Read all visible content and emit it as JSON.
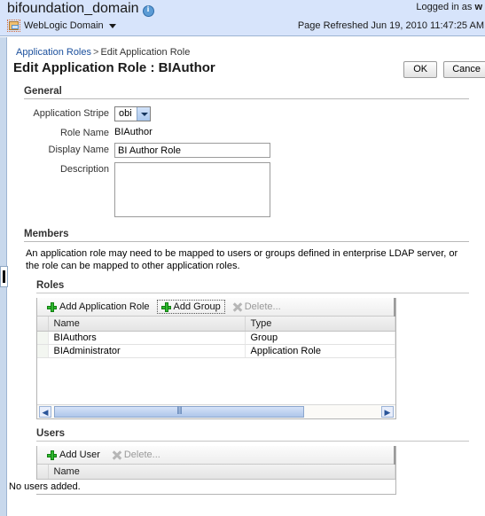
{
  "header": {
    "domain_title": "bifoundation_domain",
    "info_icon": "info-icon",
    "domain_menu_label": "WebLogic Domain",
    "domain_menu_icon": "weblogic-domain-icon",
    "caret_icon": "chevron-down-icon",
    "logged_in_prefix": "Logged in as",
    "logged_in_user": "w",
    "page_refreshed": "Page Refreshed Jun 19, 2010 11:47:25 AM",
    "background_color": "#d7e4fb"
  },
  "breadcrumb": {
    "parent": "Application Roles",
    "separator": ">",
    "current": "Edit Application Role"
  },
  "page": {
    "title": "Edit Application Role : BIAuthor"
  },
  "actions": {
    "ok_label": "OK",
    "cancel_label": "Cance"
  },
  "general": {
    "heading": "General",
    "fields": [
      {
        "label": "Application Stripe",
        "value": "obi",
        "type": "select"
      },
      {
        "label": "Role Name",
        "value": "BIAuthor",
        "type": "static"
      },
      {
        "label": "Display Name",
        "value": "BI Author Role",
        "type": "text"
      },
      {
        "label": "Description",
        "value": "",
        "type": "textarea"
      }
    ]
  },
  "members": {
    "heading": "Members",
    "description": "An application role may need to be mapped to users or groups defined in enterprise LDAP server, or the role can be mapped to other application roles.",
    "roles": {
      "heading": "Roles",
      "toolbar": {
        "add_application_role": "Add Application Role",
        "add_group": "Add Group",
        "delete": "Delete..."
      },
      "columns": [
        "Name",
        "Type"
      ],
      "rows": [
        {
          "name": "BIAuthors",
          "type": "Group"
        },
        {
          "name": "BIAdministrator",
          "type": "Application Role"
        }
      ],
      "scrollbar": {
        "left_arrow": "scroll-left-icon",
        "right_arrow": "scroll-right-icon"
      }
    },
    "users": {
      "heading": "Users",
      "toolbar": {
        "add_user": "Add User",
        "delete": "Delete..."
      },
      "columns": [
        "Name"
      ],
      "empty_message": "No users added."
    }
  }
}
